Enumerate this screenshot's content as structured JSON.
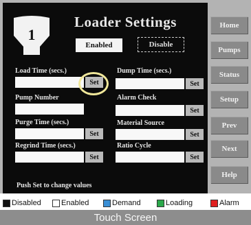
{
  "screen": {
    "badge_number": "1",
    "title": "Loader  Settings",
    "enabled_label": "Enabled",
    "disable_label": "Disable",
    "set_label": "Set",
    "hint": "Push Set to change values",
    "fields": [
      {
        "label": "Load Time (secs.)",
        "value": ""
      },
      {
        "label": "Dump Time (secs.)",
        "value": ""
      },
      {
        "label": "Pump Number",
        "value": ""
      },
      {
        "label": "Alarm Check",
        "value": ""
      },
      {
        "label": "Purge Time (secs.)",
        "value": ""
      },
      {
        "label": "Material Source",
        "value": ""
      },
      {
        "label": "Regrind Time (secs.)",
        "value": ""
      },
      {
        "label": "Ratio Cycle",
        "value": ""
      }
    ]
  },
  "nav": [
    "Home",
    "Pumps",
    "Status",
    "Setup",
    "Prev",
    "Next",
    "Help"
  ],
  "legend": [
    {
      "label": "Disabled",
      "color": "#111111"
    },
    {
      "label": "Enabled",
      "color": "#ffffff"
    },
    {
      "label": "Demand",
      "color": "#3a8fd6"
    },
    {
      "label": "Loading",
      "color": "#2aa84a"
    },
    {
      "label": "Alarm",
      "color": "#e02020"
    }
  ],
  "footer": "Touch Screen"
}
